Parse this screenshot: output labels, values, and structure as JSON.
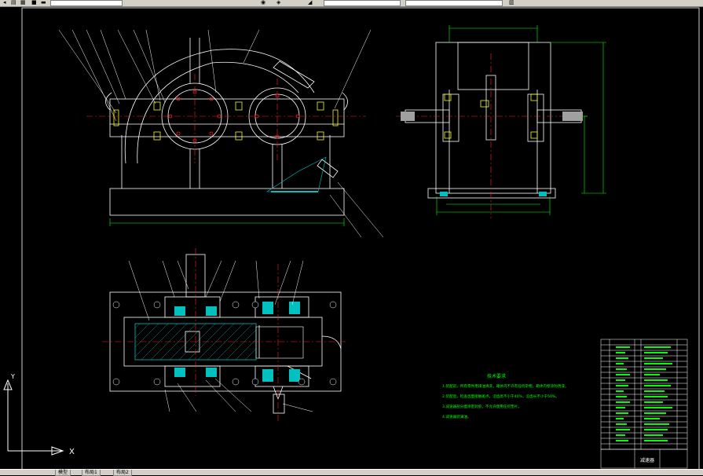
{
  "toolbar": {
    "items": [
      {
        "icon": "arrow-icon"
      },
      {
        "icon": "layer-icon"
      },
      {
        "icon": "properties-icon"
      },
      {
        "icon": "color-icon"
      },
      {
        "icon": "linetype-icon"
      },
      {
        "icon": "lineweight-icon"
      }
    ]
  },
  "drawing": {
    "title_block_label": "减速器",
    "tech_req_title": "技术要求",
    "tech_req_lines": [
      "1.装配前，所有零件用煤油清洗，箱体内不许有任何杂物，箱体内壁涂防锈漆。",
      "2.装配后，检查齿面接触斑点，沿齿高不小于40%，沿齿长不小于50%。",
      "3.减速器剖分面涂密封胶，不允许使用任何垫片。",
      "4.减速器装满油。"
    ],
    "colors": {
      "outline": "#ffffff",
      "center": "#ff2020",
      "dimension": "#00ff00",
      "hatch": "#00c0c0",
      "annotation": "#ffff00"
    }
  },
  "ucs": {
    "x_label": "X",
    "y_label": "Y"
  },
  "tabs": [
    "模型",
    "布局1",
    "布局2"
  ]
}
